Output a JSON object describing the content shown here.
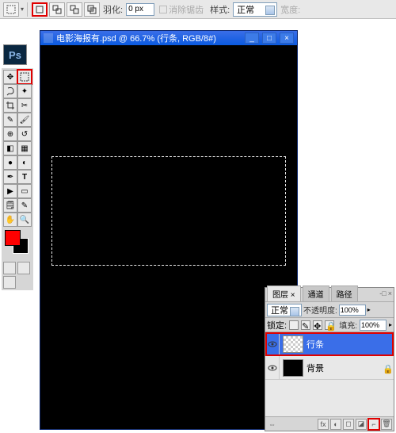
{
  "options": {
    "feather_label": "羽化:",
    "feather_value": "0 px",
    "antialias_label": "消除锯齿",
    "style_label": "样式:",
    "style_value": "正常",
    "width_label": "宽度:"
  },
  "app": {
    "logo": "Ps"
  },
  "document": {
    "title": "电影海报有.psd @ 66.7% (行条, RGB/8#)"
  },
  "layers_panel": {
    "tabs": [
      "图层 ×",
      "通道",
      "路径"
    ],
    "blend_mode": "正常",
    "opacity_label": "不透明度:",
    "opacity_value": "100%",
    "lock_label": "锁定:",
    "fill_label": "填充:",
    "fill_value": "100%",
    "layers": [
      {
        "name": "行条",
        "selected": true,
        "thumb": "checker"
      },
      {
        "name": "背景",
        "selected": false,
        "thumb": "bg",
        "locked": true
      }
    ],
    "footer_link": "⇔",
    "footer_icons": [
      "fx",
      "◐",
      "◻",
      "◪",
      "⌐",
      "🗑"
    ]
  }
}
